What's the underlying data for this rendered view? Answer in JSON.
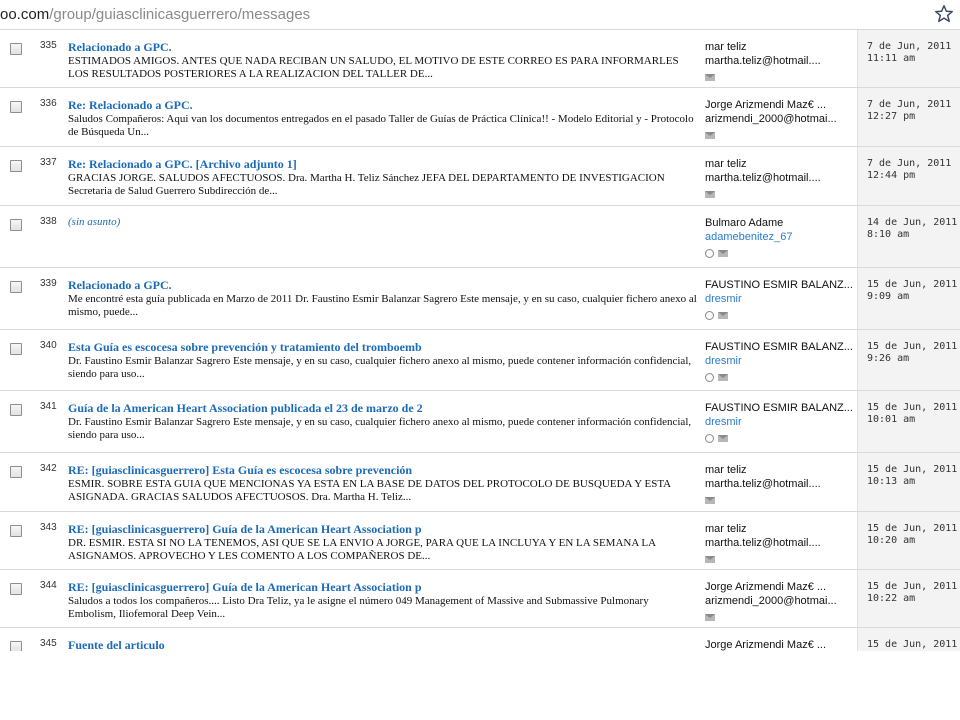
{
  "url": {
    "domain": "oo.com",
    "path": "/group/guiasclinicasguerrero/messages"
  },
  "messages": [
    {
      "num": "335",
      "subject": "Relacionado a GPC.",
      "snippet": "ESTIMADOS AMIGOS. ANTES QUE NADA RECIBAN UN SALUDO, EL MOTIVO DE ESTE CORREO ES PARA INFORMARLES LOS RESULTADOS POSTERIORES A LA REALIZACION DEL TALLER DE...",
      "author": "mar teliz",
      "email": "martha.teliz@hotmail....",
      "date": "7 de Jun, 2011",
      "time": "11:11 am"
    },
    {
      "num": "336",
      "subject": "Re: Relacionado a GPC.",
      "snippet": "Saludos Compañeros: Aqui van los documentos entregados en el pasado Taller de Guías de Práctica Clínica!! - Modelo Editorial y - Protocolo de Búsqueda Un...",
      "author": "Jorge Arizmendi Maz€ ...",
      "email": "arizmendi_2000@hotmai...",
      "date": "7 de Jun, 2011",
      "time": "12:27 pm"
    },
    {
      "num": "337",
      "subject": "Re: Relacionado a GPC. [Archivo adjunto 1]",
      "snippet": "GRACIAS JORGE. SALUDOS AFECTUOSOS. Dra. Martha H. Teliz Sánchez JEFA DEL DEPARTAMENTO DE INVESTIGACION Secretaria de Salud Guerrero Subdirección de...",
      "author": "mar teliz",
      "email": "martha.teliz@hotmail....",
      "date": "7 de Jun, 2011",
      "time": "12:44 pm"
    },
    {
      "num": "338",
      "subject": "(sin asunto)",
      "snippet": "",
      "author": "Bulmaro Adame",
      "email": "adamebenitez_67",
      "date": "14 de Jun, 2011",
      "time": "8:10 am"
    },
    {
      "num": "339",
      "subject": "Relacionado a GPC.",
      "snippet": "Me encontré esta guía publicada en Marzo de 2011 Dr. Faustino Esmir Balanzar Sagrero Este mensaje, y en su caso, cualquier fichero anexo al mismo, puede...",
      "author": "FAUSTINO ESMIR BALANZ...",
      "email": "dresmir",
      "date": "15 de Jun, 2011",
      "time": "9:09 am"
    },
    {
      "num": "340",
      "subject": "Esta Guía es escocesa sobre prevención y tratamiento del tromboemb",
      "snippet": "Dr. Faustino Esmir Balanzar Sagrero Este mensaje, y en su caso, cualquier fichero anexo al mismo, puede contener información confidencial, siendo para uso...",
      "author": "FAUSTINO ESMIR BALANZ...",
      "email": "dresmir",
      "date": "15 de Jun, 2011",
      "time": "9:26 am"
    },
    {
      "num": "341",
      "subject": "Guía de la American Heart Association publicada el 23 de marzo de 2",
      "snippet": "Dr. Faustino Esmir Balanzar Sagrero Este mensaje, y en su caso, cualquier fichero anexo al mismo, puede contener información confidencial, siendo para uso...",
      "author": "FAUSTINO ESMIR BALANZ...",
      "email": "dresmir",
      "date": "15 de Jun, 2011",
      "time": "10:01 am"
    },
    {
      "num": "342",
      "subject": "RE: [guiasclinicasguerrero] Esta Guía es escocesa sobre prevención",
      "snippet": "ESMIR. SOBRE ESTA GUIA QUE MENCIONAS YA ESTA EN LA BASE DE DATOS DEL PROTOCOLO DE BUSQUEDA Y ESTA ASIGNADA. GRACIAS SALUDOS AFECTUOSOS. Dra. Martha H. Teliz...",
      "author": "mar teliz",
      "email": "martha.teliz@hotmail....",
      "date": "15 de Jun, 2011",
      "time": "10:13 am"
    },
    {
      "num": "343",
      "subject": "RE: [guiasclinicasguerrero] Guía de la American Heart Association p",
      "snippet": "DR. ESMIR. ESTA SI NO LA TENEMOS, ASI QUE SE LA ENVIO A JORGE, PARA QUE LA INCLUYA Y EN LA SEMANA LA ASIGNAMOS. APROVECHO Y LES COMENTO A LOS COMPAÑEROS DE...",
      "author": "mar teliz",
      "email": "martha.teliz@hotmail....",
      "date": "15 de Jun, 2011",
      "time": "10:20 am"
    },
    {
      "num": "344",
      "subject": "RE: [guiasclinicasguerrero] Guía de la American Heart Association p",
      "snippet": "Saludos a todos los compañeros.... Listo Dra Teliz, ya le asigne el número 049 Management of Massive and Submassive Pulmonary Embolism, Iliofemoral Deep Vein...",
      "author": "Jorge Arizmendi Maz€ ...",
      "email": "arizmendi_2000@hotmai...",
      "date": "15 de Jun, 2011",
      "time": "10:22 am"
    },
    {
      "num": "345",
      "subject": "Fuente del articulo",
      "snippet": "",
      "author": "Jorge Arizmendi Maz€ ...",
      "email": "",
      "date": "15 de Jun, 2011",
      "time": ""
    }
  ]
}
